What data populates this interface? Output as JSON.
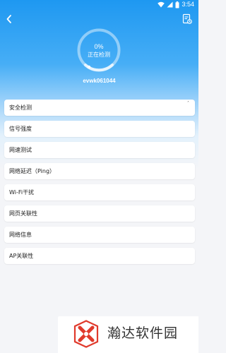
{
  "status_bar": {
    "time": "3:54",
    "icons": [
      "wifi-icon",
      "signal-icon",
      "battery-icon"
    ]
  },
  "header": {
    "back_icon": "chevron-left-icon",
    "report_icon": "report-document-icon"
  },
  "scan": {
    "progress_percent": "0%",
    "progress_value": 0,
    "status_text": "正在检测",
    "network_name": "evwk061044"
  },
  "check_items": [
    {
      "label": "安全检测"
    },
    {
      "label": "信号强度"
    },
    {
      "label": "网速测试"
    },
    {
      "label": "网络延迟（Ping）"
    },
    {
      "label": "Wi-Fi干扰"
    },
    {
      "label": "网页关联性"
    },
    {
      "label": "网络信息"
    },
    {
      "label": "AP关联性"
    }
  ],
  "watermark": {
    "text": "瀚达软件园"
  },
  "colors": {
    "header_blue": "#1e98f1",
    "page_background": "#f4f5f8",
    "card_background": "#ffffff",
    "logo_red": "#e03a2c"
  }
}
